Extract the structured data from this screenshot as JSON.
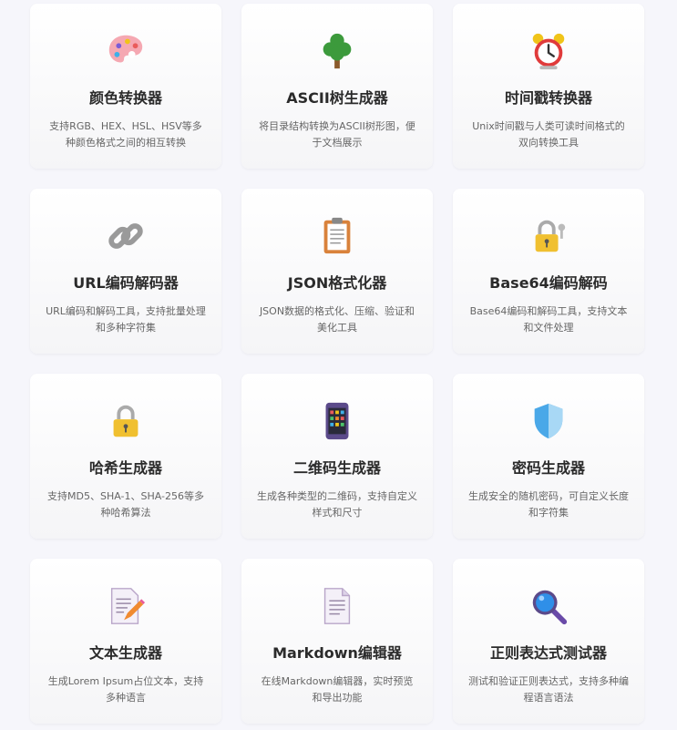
{
  "tools": [
    {
      "icon": "palette-icon",
      "title": "颜色转换器",
      "desc": "支持RGB、HEX、HSL、HSV等多种颜色格式之间的相互转换"
    },
    {
      "icon": "tree-icon",
      "title": "ASCII树生成器",
      "desc": "将目录结构转换为ASCII树形图，便于文档展示"
    },
    {
      "icon": "alarm-clock-icon",
      "title": "时间戳转换器",
      "desc": "Unix时间戳与人类可读时间格式的双向转换工具"
    },
    {
      "icon": "link-icon",
      "title": "URL编码解码器",
      "desc": "URL编码和解码工具，支持批量处理和多种字符集"
    },
    {
      "icon": "clipboard-icon",
      "title": "JSON格式化器",
      "desc": "JSON数据的格式化、压缩、验证和美化工具"
    },
    {
      "icon": "lock-with-key-icon",
      "title": "Base64编码解码",
      "desc": "Base64编码和解码工具，支持文本和文件处理"
    },
    {
      "icon": "lock-icon",
      "title": "哈希生成器",
      "desc": "支持MD5、SHA-1、SHA-256等多种哈希算法"
    },
    {
      "icon": "mobile-app-grid-icon",
      "title": "二维码生成器",
      "desc": "生成各种类型的二维码，支持自定义样式和尺寸"
    },
    {
      "icon": "shield-icon",
      "title": "密码生成器",
      "desc": "生成安全的随机密码，可自定义长度和字符集"
    },
    {
      "icon": "memo-pencil-icon",
      "title": "文本生成器",
      "desc": "生成Lorem Ipsum占位文本，支持多种语言"
    },
    {
      "icon": "document-icon",
      "title": "Markdown编辑器",
      "desc": "在线Markdown编辑器，实时预览和导出功能"
    },
    {
      "icon": "magnifier-icon",
      "title": "正则表达式测试器",
      "desc": "测试和验证正则表达式，支持多种编程语言语法"
    }
  ]
}
